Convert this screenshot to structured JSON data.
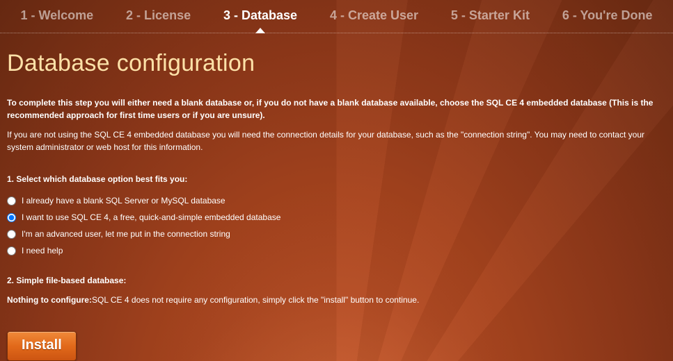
{
  "steps": [
    {
      "label": "1 - Welcome",
      "active": false
    },
    {
      "label": "2 - License",
      "active": false
    },
    {
      "label": "3 - Database",
      "active": true
    },
    {
      "label": "4 - Create User",
      "active": false
    },
    {
      "label": "5 - Starter Kit",
      "active": false
    },
    {
      "label": "6 - You're Done",
      "active": false
    }
  ],
  "heading": "Database configuration",
  "intro_bold": "To complete this step you will either need a blank database or, if you do not have a blank database available, choose the SQL CE 4 embedded database (This is the recommended approach for first time users or if you are unsure).",
  "intro_reg": "If you are not using the SQL CE 4 embedded database you will need the connection details for your database, such as the \"connection string\". You may need to contact your system administrator or web host for this information.",
  "section1_title": "1. Select which database option best fits you:",
  "options": [
    {
      "label": "I already have a blank SQL Server or MySQL database",
      "checked": false
    },
    {
      "label": "I want to use SQL CE 4, a free, quick-and-simple embedded database",
      "checked": true
    },
    {
      "label": "I'm an advanced user, let me put in the connection string",
      "checked": false
    },
    {
      "label": "I need help",
      "checked": false
    }
  ],
  "section2_title": "2. Simple file-based database:",
  "nothing_label": "Nothing to configure:",
  "nothing_text": "SQL CE 4 does not require any configuration, simply click the \"install\" button to continue.",
  "install_label": "Install"
}
